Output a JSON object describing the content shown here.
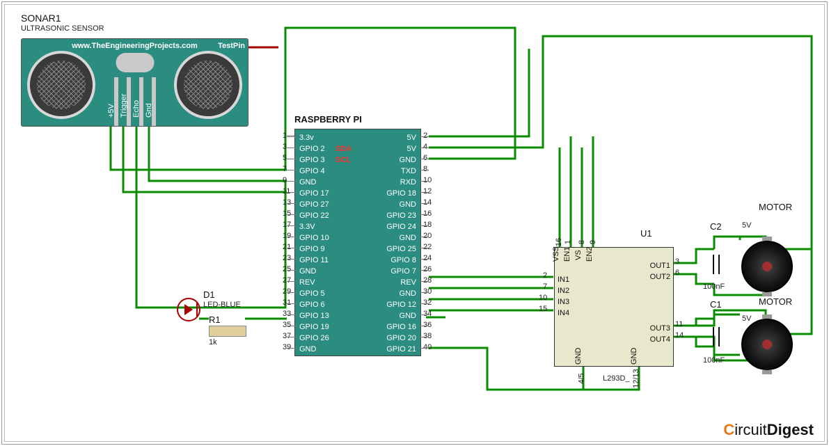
{
  "sonar": {
    "ref": "SONAR1",
    "desc": "ULTRASONIC SENSOR",
    "url": "www.TheEngineeringProjects.com",
    "testpin": "TestPin",
    "pins": [
      "+5V",
      "Trigger",
      "Echo",
      "Gnd"
    ]
  },
  "pi": {
    "title": "RASPBERRY PI",
    "rows_left": [
      "3.3v",
      "GPIO 2",
      "GPIO 3",
      "GPIO 4",
      "GND",
      "GPIO 17",
      "GPIO 27",
      "GPIO 22",
      "3.3V",
      "GPIO 10",
      "GPIO 9",
      "GPIO 11",
      "GND",
      "REV",
      "GPIO 5",
      "GPIO 6",
      "GPIO 13",
      "GPIO 19",
      "GPIO 26",
      "GND"
    ],
    "rows_right": [
      "5V",
      "5V",
      "GND",
      "TXD",
      "RXD",
      "GPIO 18",
      "GND",
      "GPIO 23",
      "GPIO 24",
      "GND",
      "GPIO 25",
      "GPIO 8",
      "GPIO 7",
      "REV",
      "GND",
      "GPIO 12",
      "GND",
      "GPIO 16",
      "GPIO 20",
      "GPIO 21"
    ],
    "sda": "SDA",
    "scl": "SCL"
  },
  "u1": {
    "ref": "U1",
    "part": "L293D_",
    "pins": {
      "in1": "IN1",
      "in2": "IN2",
      "in3": "IN3",
      "in4": "IN4",
      "out1": "OUT1",
      "out2": "OUT2",
      "out3": "OUT3",
      "out4": "OUT4",
      "vss": "VSS",
      "vs": "VS",
      "en1": "EN1",
      "en2": "EN2",
      "gnd": "GND"
    },
    "pin_nums": {
      "vss": "16",
      "en1": "1",
      "vs": "8",
      "en2": "9",
      "in1": "2",
      "in2": "7",
      "in3": "10",
      "in4": "15",
      "out1": "3",
      "out2": "6",
      "out3": "11",
      "out4": "14",
      "gnd_a": "4/5",
      "gnd_b": "12/13"
    }
  },
  "motor1": {
    "ref": "MOTOR",
    "v": "5V"
  },
  "motor2": {
    "ref": "MOTOR",
    "v": "5V"
  },
  "c1": {
    "ref": "C1",
    "val": "100nF"
  },
  "c2": {
    "ref": "C2",
    "val": "100nF"
  },
  "d1": {
    "ref": "D1",
    "part": "LED-BLUE"
  },
  "r1": {
    "ref": "R1",
    "val": "1k"
  },
  "logo": {
    "a": "C",
    "thin": "ircuit",
    "b": "Digest"
  }
}
